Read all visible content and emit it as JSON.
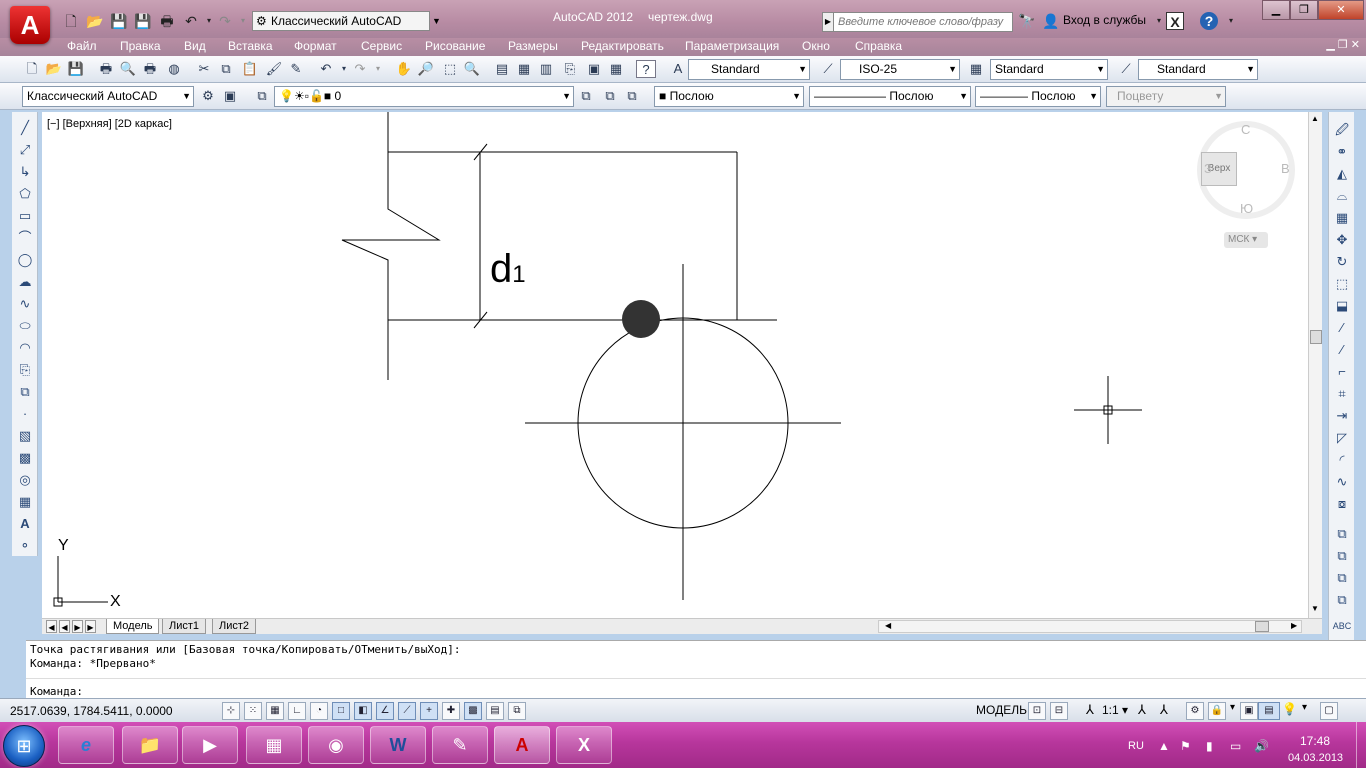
{
  "title_bar": {
    "app_name": "AutoCAD 2012",
    "file_name": "чертеж.dwg",
    "workspace": "Классический AutoCAD",
    "search_placeholder": "Введите ключевое слово/фразу",
    "login": "Вход в службы",
    "logo_letter": "A"
  },
  "menu": {
    "items": [
      "Файл",
      "Правка",
      "Вид",
      "Вставка",
      "Формат",
      "Сервис",
      "Рисование",
      "Размеры",
      "Редактировать",
      "Параметризация",
      "Окно",
      "Справка"
    ]
  },
  "toolbar1": {
    "text_style": "Standard",
    "dim_style": "ISO-25",
    "table_style": "Standard",
    "mleader_style": "Standard"
  },
  "toolbar2": {
    "workspace": "Классический AutoCAD",
    "layer": "0",
    "color": "Послою",
    "linetype": "Послою",
    "lineweight": "Послою",
    "plotstyle": "Поцвету"
  },
  "viewport": {
    "label": "[−] [Верхняя] [2D каркас]",
    "dimension_text": "d",
    "dimension_sub": "1"
  },
  "viewcube": {
    "top": "Верх",
    "north": "С",
    "south": "Ю",
    "west": "З",
    "east": "В",
    "wcs": "МСК"
  },
  "ucs": {
    "x": "X",
    "y": "Y"
  },
  "tabs": [
    "Модель",
    "Лист1",
    "Лист2"
  ],
  "command": {
    "line1": "Точка растягивания или [Базовая точка/Копировать/ОТменить/выХод]:",
    "line2": "Команда: *Прервано*",
    "prompt": "Команда:"
  },
  "status": {
    "coords": "2517.0639, 1784.5411, 0.0000",
    "model": "МОДЕЛЬ",
    "scale": "1:1"
  },
  "taskbar": {
    "lang": "RU",
    "time": "17:48",
    "date": "04.03.2013"
  },
  "colors": {
    "titlebar": "#b78ba3",
    "taskbar": "#b7369c",
    "grip": "#333333"
  }
}
